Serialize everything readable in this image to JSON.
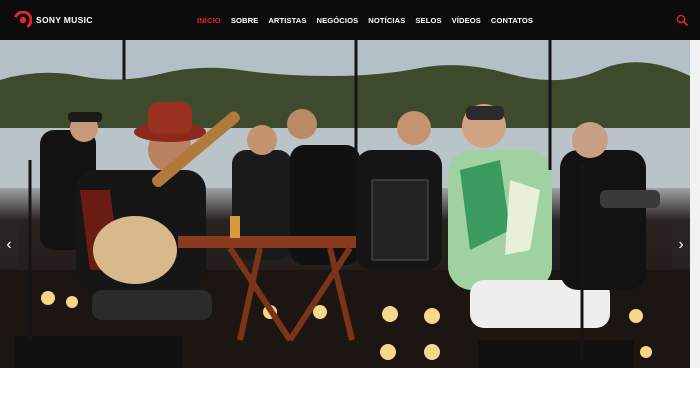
{
  "brand": {
    "name": "SONY MUSIC",
    "color": "#e0262c"
  },
  "nav": {
    "items": [
      {
        "label": "INÍCIO",
        "active": true
      },
      {
        "label": "SOBRE",
        "active": false
      },
      {
        "label": "ARTISTAS",
        "active": false
      },
      {
        "label": "NEGÓCIOS",
        "active": false
      },
      {
        "label": "NOTÍCIAS",
        "active": false
      },
      {
        "label": "SELOS",
        "active": false
      },
      {
        "label": "VÍDEOS",
        "active": false
      },
      {
        "label": "CONTATOS",
        "active": false
      }
    ],
    "search_icon": "search-icon"
  },
  "hero": {
    "prev_arrow": "‹",
    "next_arrow": "›",
    "image": "band-performing-outdoors-by-river"
  }
}
